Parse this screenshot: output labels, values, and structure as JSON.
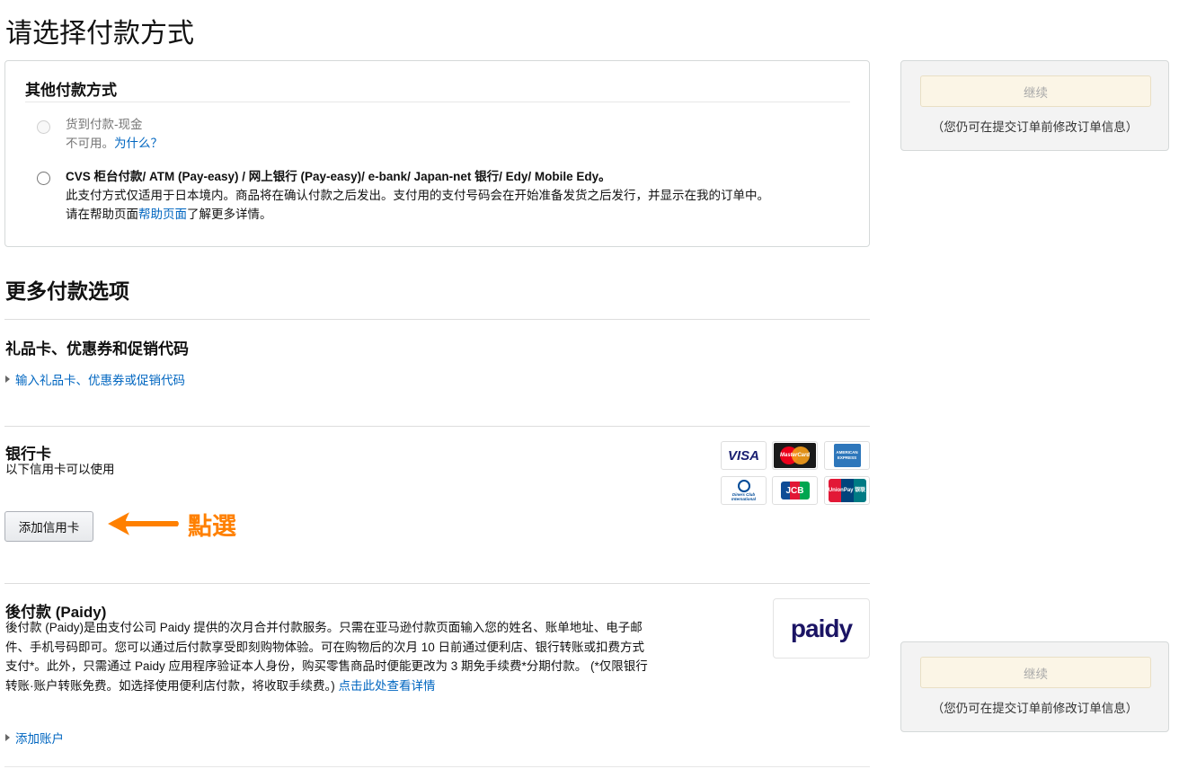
{
  "page_title": "请选择付款方式",
  "other_methods": {
    "title": "其他付款方式",
    "cod": {
      "label": "货到付款-现金",
      "unavailable": "不可用。",
      "why": "为什么？"
    },
    "cvs": {
      "label": "CVS 柜台付款/ ATM (Pay-easy) / 网上银行 (Pay-easy)/ e-bank/ Japan-net 银行/ Edy/ Mobile Edy。",
      "desc": "此支付方式仅适用于日本境内。商品将在确认付款之后发出。支付用的支付号码会在开始准备发货之后发行，并显示在我的订单中。",
      "help_prefix": "请在帮助页面",
      "help_link": "帮助页面",
      "help_suffix": "了解更多详情。"
    }
  },
  "more_options": {
    "title": "更多付款选项",
    "gift": {
      "title": "礼品卡、优惠券和促销代码",
      "link": "输入礼品卡、优惠券或促销代码"
    },
    "bank_card": {
      "title": "银行卡",
      "subtitle": "以下信用卡可以使用",
      "add_button": "添加信用卡",
      "annotation": "點選",
      "logos": [
        {
          "name": "visa-logo",
          "text": "VISA"
        },
        {
          "name": "mastercard-logo",
          "text": "MasterCard"
        },
        {
          "name": "amex-logo",
          "text": "AMERICAN EXPRESS"
        },
        {
          "name": "diners-logo",
          "text": "Diners Club International"
        },
        {
          "name": "jcb-logo",
          "text": "JCB"
        },
        {
          "name": "unionpay-logo",
          "text": "UnionPay 银联"
        }
      ]
    },
    "paidy": {
      "title": "後付款 (Paidy)",
      "desc": "後付款 (Paidy)是由支付公司 Paidy 提供的次月合并付款服务。只需在亚马逊付款页面输入您的姓名、账单地址、电子邮件、手机号码即可。您可以通过后付款享受即刻购物体验。可在购物后的次月 10 日前通过便利店、银行转账或扣费方式支付*。此外，只需通过 Paidy 应用程序验证本人身份，购买零售商品时便能更改为 3 期免手续费*分期付款。 (*仅限银行转账·账户转账免费。如选择使用便利店付款，将收取手续费。) ",
      "details_link": "点击此处查看详情",
      "logo": "paidy",
      "add_account": "添加账户"
    }
  },
  "sidebar": {
    "continue_label": "继续",
    "note": "（您仍可在提交订单前修改订单信息）"
  },
  "colors": {
    "link": "#0066c0",
    "annotation": "#ff8000",
    "paidy_brand": "#1b1464",
    "paidy_accent": "#e5007f"
  }
}
